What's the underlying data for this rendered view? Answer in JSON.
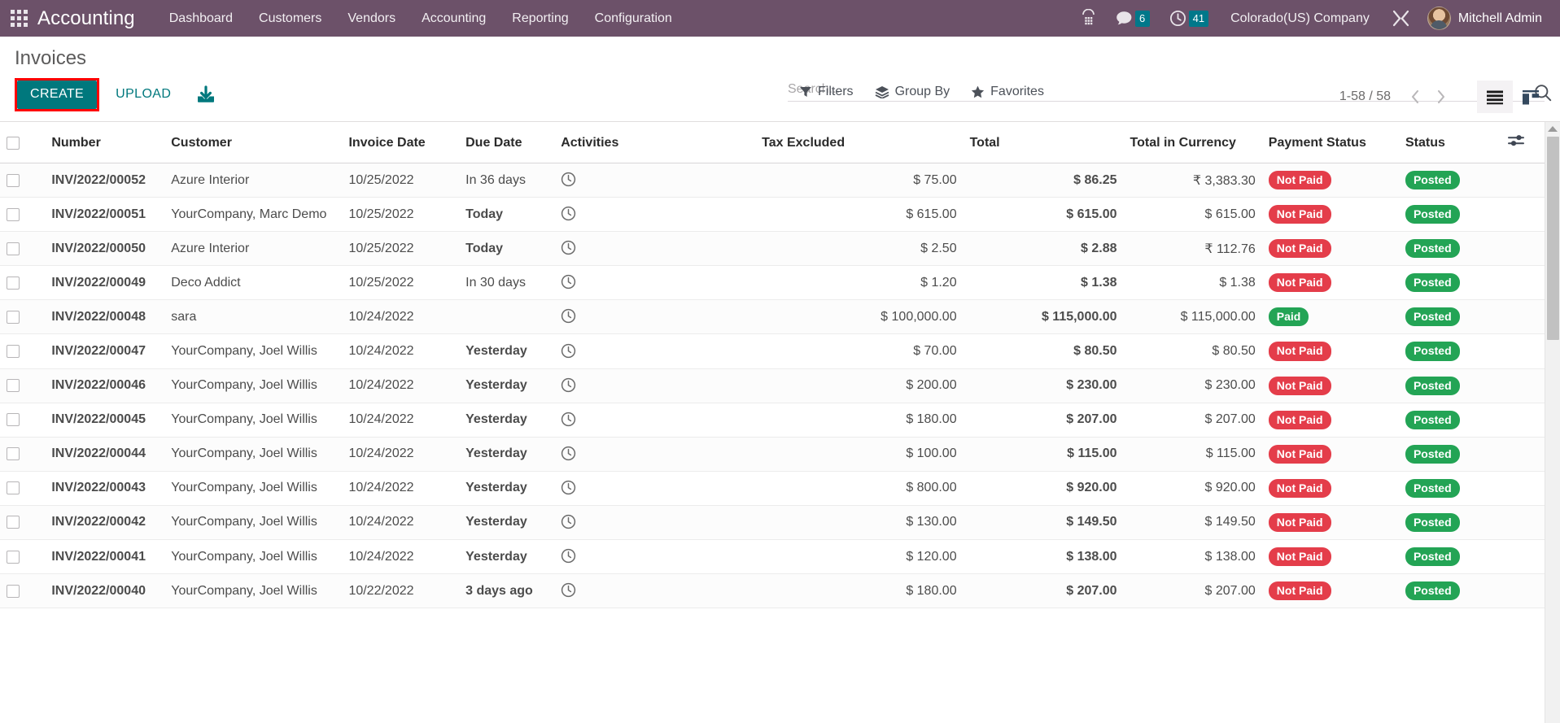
{
  "navbar": {
    "apps_icon": "apps-grid-icon",
    "brand": "Accounting",
    "menu": [
      {
        "label": "Dashboard"
      },
      {
        "label": "Customers"
      },
      {
        "label": "Vendors"
      },
      {
        "label": "Accounting"
      },
      {
        "label": "Reporting"
      },
      {
        "label": "Configuration"
      }
    ],
    "voip_icon": "phone-dialpad-icon",
    "messages": {
      "icon": "chat-bubble-icon",
      "count": "6"
    },
    "activities": {
      "icon": "clock-icon",
      "count": "41"
    },
    "company": "Colorado(US) Company",
    "debug_icon": "tools-wrench-icon",
    "user": "Mitchell Admin",
    "avatar": "user-avatar"
  },
  "control_panel": {
    "title": "Invoices",
    "create_label": "CREATE",
    "upload_label": "UPLOAD",
    "download_icon": "download-inbox-icon",
    "highlight_color": "#ff0000",
    "accent_color": "#00787d"
  },
  "search": {
    "placeholder": "Search...",
    "value": "",
    "search_icon": "search-magnifier-icon"
  },
  "filters": [
    {
      "label": "Filters",
      "icon": "filter-funnel-icon"
    },
    {
      "label": "Group By",
      "icon": "layers-icon"
    },
    {
      "label": "Favorites",
      "icon": "star-icon"
    }
  ],
  "pager": {
    "range": "1-58 / 58",
    "prev_icon": "chevron-left-icon",
    "next_icon": "chevron-right-icon"
  },
  "views": [
    {
      "name": "list",
      "icon": "list-view-icon",
      "active": true
    },
    {
      "name": "kanban",
      "icon": "kanban-view-icon",
      "active": false
    }
  ],
  "table": {
    "optional_columns_icon": "sliders-adjust-icon",
    "columns": [
      {
        "key": "checkbox",
        "label": ""
      },
      {
        "key": "number",
        "label": "Number"
      },
      {
        "key": "customer",
        "label": "Customer"
      },
      {
        "key": "invoice_date",
        "label": "Invoice Date"
      },
      {
        "key": "due_date",
        "label": "Due Date"
      },
      {
        "key": "activities",
        "label": "Activities"
      },
      {
        "key": "tax_excluded",
        "label": "Tax Excluded"
      },
      {
        "key": "total",
        "label": "Total"
      },
      {
        "key": "total_in_currency",
        "label": "Total in Currency"
      },
      {
        "key": "payment_status",
        "label": "Payment Status"
      },
      {
        "key": "status",
        "label": "Status"
      }
    ],
    "rows": [
      {
        "number": "INV/2022/00052",
        "customer": "Azure Interior",
        "invoice_date": "10/25/2022",
        "due_date": "In 36 days",
        "due_style": "normal",
        "activity_icon": "clock-icon",
        "tax_excluded": "$ 75.00",
        "total": "$ 86.25",
        "total_in_currency": "₹ 3,383.30",
        "payment_status": "Not Paid",
        "payment_style": "notpaid",
        "status": "Posted",
        "status_style": "posted"
      },
      {
        "number": "INV/2022/00051",
        "customer": "YourCompany, Marc Demo",
        "invoice_date": "10/25/2022",
        "due_date": "Today",
        "due_style": "today",
        "activity_icon": "clock-icon",
        "tax_excluded": "$ 615.00",
        "total": "$ 615.00",
        "total_in_currency": "$ 615.00",
        "payment_status": "Not Paid",
        "payment_style": "notpaid",
        "status": "Posted",
        "status_style": "posted"
      },
      {
        "number": "INV/2022/00050",
        "customer": "Azure Interior",
        "invoice_date": "10/25/2022",
        "due_date": "Today",
        "due_style": "today",
        "activity_icon": "clock-icon",
        "tax_excluded": "$ 2.50",
        "total": "$ 2.88",
        "total_in_currency": "₹ 112.76",
        "payment_status": "Not Paid",
        "payment_style": "notpaid",
        "status": "Posted",
        "status_style": "posted"
      },
      {
        "number": "INV/2022/00049",
        "customer": "Deco Addict",
        "invoice_date": "10/25/2022",
        "due_date": "In 30 days",
        "due_style": "normal",
        "activity_icon": "clock-icon",
        "tax_excluded": "$ 1.20",
        "total": "$ 1.38",
        "total_in_currency": "$ 1.38",
        "payment_status": "Not Paid",
        "payment_style": "notpaid",
        "status": "Posted",
        "status_style": "posted"
      },
      {
        "number": "INV/2022/00048",
        "customer": "sara",
        "invoice_date": "10/24/2022",
        "due_date": "",
        "due_style": "normal",
        "activity_icon": "clock-icon",
        "tax_excluded": "$ 100,000.00",
        "total": "$ 115,000.00",
        "total_in_currency": "$ 115,000.00",
        "payment_status": "Paid",
        "payment_style": "paid",
        "status": "Posted",
        "status_style": "posted"
      },
      {
        "number": "INV/2022/00047",
        "customer": "YourCompany, Joel Willis",
        "invoice_date": "10/24/2022",
        "due_date": "Yesterday",
        "due_style": "late",
        "activity_icon": "clock-icon",
        "tax_excluded": "$ 70.00",
        "total": "$ 80.50",
        "total_in_currency": "$ 80.50",
        "payment_status": "Not Paid",
        "payment_style": "notpaid",
        "status": "Posted",
        "status_style": "posted"
      },
      {
        "number": "INV/2022/00046",
        "customer": "YourCompany, Joel Willis",
        "invoice_date": "10/24/2022",
        "due_date": "Yesterday",
        "due_style": "late",
        "activity_icon": "clock-icon",
        "tax_excluded": "$ 200.00",
        "total": "$ 230.00",
        "total_in_currency": "$ 230.00",
        "payment_status": "Not Paid",
        "payment_style": "notpaid",
        "status": "Posted",
        "status_style": "posted"
      },
      {
        "number": "INV/2022/00045",
        "customer": "YourCompany, Joel Willis",
        "invoice_date": "10/24/2022",
        "due_date": "Yesterday",
        "due_style": "late",
        "activity_icon": "clock-icon",
        "tax_excluded": "$ 180.00",
        "total": "$ 207.00",
        "total_in_currency": "$ 207.00",
        "payment_status": "Not Paid",
        "payment_style": "notpaid",
        "status": "Posted",
        "status_style": "posted"
      },
      {
        "number": "INV/2022/00044",
        "customer": "YourCompany, Joel Willis",
        "invoice_date": "10/24/2022",
        "due_date": "Yesterday",
        "due_style": "late",
        "activity_icon": "clock-icon",
        "tax_excluded": "$ 100.00",
        "total": "$ 115.00",
        "total_in_currency": "$ 115.00",
        "payment_status": "Not Paid",
        "payment_style": "notpaid",
        "status": "Posted",
        "status_style": "posted"
      },
      {
        "number": "INV/2022/00043",
        "customer": "YourCompany, Joel Willis",
        "invoice_date": "10/24/2022",
        "due_date": "Yesterday",
        "due_style": "late",
        "activity_icon": "clock-icon",
        "tax_excluded": "$ 800.00",
        "total": "$ 920.00",
        "total_in_currency": "$ 920.00",
        "payment_status": "Not Paid",
        "payment_style": "notpaid",
        "status": "Posted",
        "status_style": "posted"
      },
      {
        "number": "INV/2022/00042",
        "customer": "YourCompany, Joel Willis",
        "invoice_date": "10/24/2022",
        "due_date": "Yesterday",
        "due_style": "late",
        "activity_icon": "clock-icon",
        "tax_excluded": "$ 130.00",
        "total": "$ 149.50",
        "total_in_currency": "$ 149.50",
        "payment_status": "Not Paid",
        "payment_style": "notpaid",
        "status": "Posted",
        "status_style": "posted"
      },
      {
        "number": "INV/2022/00041",
        "customer": "YourCompany, Joel Willis",
        "invoice_date": "10/24/2022",
        "due_date": "Yesterday",
        "due_style": "late",
        "activity_icon": "clock-icon",
        "tax_excluded": "$ 120.00",
        "total": "$ 138.00",
        "total_in_currency": "$ 138.00",
        "payment_status": "Not Paid",
        "payment_style": "notpaid",
        "status": "Posted",
        "status_style": "posted"
      },
      {
        "number": "INV/2022/00040",
        "customer": "YourCompany, Joel Willis",
        "invoice_date": "10/22/2022",
        "due_date": "3 days ago",
        "due_style": "late",
        "activity_icon": "clock-icon",
        "tax_excluded": "$ 180.00",
        "total": "$ 207.00",
        "total_in_currency": "$ 207.00",
        "payment_status": "Not Paid",
        "payment_style": "notpaid",
        "status": "Posted",
        "status_style": "posted"
      }
    ]
  }
}
